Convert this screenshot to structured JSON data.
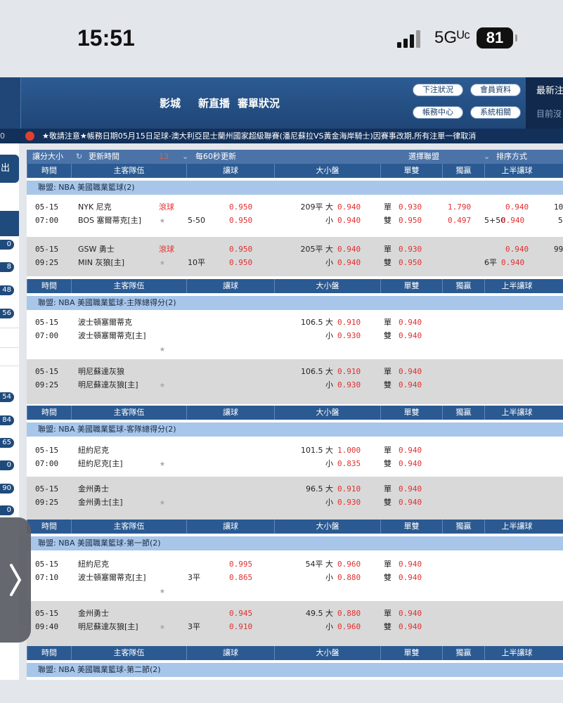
{
  "status": {
    "time": "15:51",
    "network": "5Gᵁᶜ",
    "battery": "81"
  },
  "nav": {
    "cinema": "影城",
    "live": "新直播",
    "review": "審單狀況"
  },
  "buttons": {
    "bet_status": "下注狀況",
    "member_info": "會員資料",
    "account_center": "帳務中心",
    "system": "系統相關"
  },
  "right_panel": {
    "title": "最新注",
    "subtitle": "目前沒"
  },
  "ticker": {
    "left": "0",
    "text": "★敬請注意★帳務日期05月15日足球-澳大利亞昆士蘭州國家超級聯賽(潘尼蘇拉VS黃金海岸騎士)因賽事改期,所有注單一律取消"
  },
  "sidebar": {
    "top_label": "出",
    "badges": [
      "0",
      "8",
      "48",
      "56",
      "54",
      "84",
      "65",
      "0",
      "90",
      "0"
    ]
  },
  "toolbar": {
    "size": "讓分大小",
    "refresh": "更新時間",
    "refresh_val": "13",
    "interval": "每60秒更新",
    "select_league": "選擇聯盟",
    "sort": "排序方式"
  },
  "columns": {
    "time": "時間",
    "teams": "主客隊伍",
    "spread": "讓球",
    "ou": "大小盤",
    "oe": "單雙",
    "ml": "獨贏",
    "half": "上半讓球"
  },
  "sections": [
    {
      "league": "聯盟: NBA 美國職業籃球(2)",
      "games": [
        {
          "date": "05-15",
          "time": "07:00",
          "t1": "NYK 尼克",
          "t2": "BOS 塞爾蒂克[主]",
          "live": "滾球",
          "line": "5-50",
          "s1": "0.950",
          "s2": "0.950",
          "ou_line": "209平 大",
          "ou1": "0.940",
          "ou_small": "小",
          "ou2": "0.940",
          "odd": "單",
          "o1": "0.930",
          "even": "雙",
          "o2": "0.950",
          "m1": "1.790",
          "m2": "0.497",
          "h_line": "5+50",
          "h1": "0.940",
          "h2": "0.940",
          "x1": "10",
          "x2": "5"
        },
        {
          "date": "05-15",
          "time": "09:25",
          "t1": "GSW 勇士",
          "t2": "MIN 灰狼[主]",
          "live": "滾球",
          "line": "10平",
          "s1": "0.950",
          "s2": "0.950",
          "ou_line": "205平 大",
          "ou1": "0.940",
          "ou_small": "小",
          "ou2": "0.940",
          "odd": "單",
          "o1": "0.930",
          "even": "雙",
          "o2": "0.950",
          "m1": "",
          "m2": "",
          "h_line": "6平",
          "h1": "0.940",
          "h2": "0.940",
          "x1": "99.",
          "x2": ""
        }
      ]
    },
    {
      "league": "聯盟: NBA 美國職業籃球-主隊總得分(2)",
      "games": [
        {
          "date": "05-15",
          "time": "07:00",
          "t1": "波士頓塞爾蒂克",
          "t2": "波士頓塞爾蒂克[主]",
          "ou_line": "106.5 大",
          "ou1": "0.910",
          "ou_small": "小",
          "ou2": "0.930",
          "odd": "單",
          "o1": "0.940",
          "even": "雙",
          "o2": "0.940"
        },
        {
          "date": "05-15",
          "time": "09:25",
          "t1": "明尼蘇達灰狼",
          "t2": "明尼蘇達灰狼[主]",
          "ou_line": "106.5 大",
          "ou1": "0.910",
          "ou_small": "小",
          "ou2": "0.930",
          "odd": "單",
          "o1": "0.940",
          "even": "雙",
          "o2": "0.940"
        }
      ]
    },
    {
      "league": "聯盟: NBA 美國職業籃球-客隊總得分(2)",
      "games": [
        {
          "date": "05-15",
          "time": "07:00",
          "t1": "紐約尼克",
          "t2": "紐約尼克[主]",
          "ou_line": "101.5 大",
          "ou1": "1.000",
          "ou_small": "小",
          "ou2": "0.835",
          "odd": "單",
          "o1": "0.940",
          "even": "雙",
          "o2": "0.940"
        },
        {
          "date": "05-15",
          "time": "09:25",
          "t1": "金州勇士",
          "t2": "金州勇士[主]",
          "ou_line": "96.5 大",
          "ou1": "0.910",
          "ou_small": "小",
          "ou2": "0.930",
          "odd": "單",
          "o1": "0.940",
          "even": "雙",
          "o2": "0.940"
        }
      ]
    },
    {
      "league": "聯盟: NBA 美國職業籃球-第一節(2)",
      "games": [
        {
          "date": "05-15",
          "time": "07:10",
          "t1": "紐約尼克",
          "t2": "波士頓塞爾蒂克[主]",
          "line": "3平",
          "s1": "0.995",
          "s2": "0.865",
          "ou_line": "54平 大",
          "ou1": "0.960",
          "ou_small": "小",
          "ou2": "0.880",
          "odd": "單",
          "o1": "0.940",
          "even": "雙",
          "o2": "0.940"
        },
        {
          "date": "05-15",
          "time": "09:40",
          "t1": "金州勇士",
          "t2": "明尼蘇達灰狼[主]",
          "line": "3平",
          "s1": "0.945",
          "s2": "0.910",
          "ou_line": "49.5 大",
          "ou1": "0.880",
          "ou_small": "小",
          "ou2": "0.960",
          "odd": "單",
          "o1": "0.940",
          "even": "雙",
          "o2": "0.940"
        }
      ]
    },
    {
      "league": "聯盟: NBA 美國職業籃球-第二節(2)",
      "games": []
    }
  ]
}
